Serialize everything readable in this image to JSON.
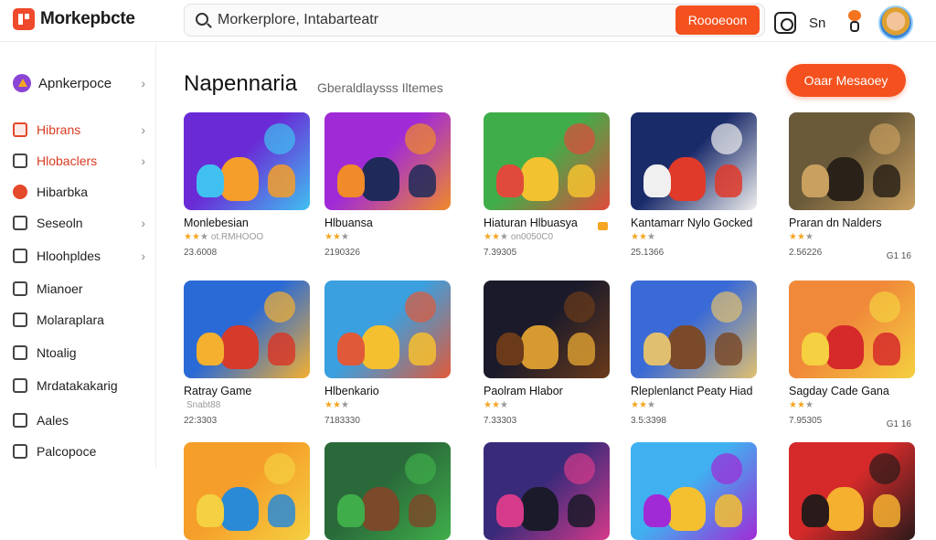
{
  "app": {
    "name": "Morkepbcte",
    "brand_color": "#f4511e"
  },
  "search": {
    "placeholder": "Morkerplore, Intabarteatr",
    "button_label": "Roooeoon"
  },
  "top_icons": {
    "language_label": "Sn"
  },
  "sidebar": {
    "header_label": "Apnkerpoce",
    "items": [
      {
        "label": "Hibrans",
        "icon": "tag-icon",
        "chevron": true,
        "active": true
      },
      {
        "label": "Hlobaclers",
        "icon": "controller-icon",
        "chevron": true,
        "active": true
      },
      {
        "label": "Hibarbka",
        "icon": "flame-icon",
        "chevron": false,
        "active": false
      },
      {
        "label": "Seseoln",
        "icon": "compass-icon",
        "chevron": true,
        "active": false
      },
      {
        "label": "Hloohpldes",
        "icon": "puzzle-icon",
        "chevron": true,
        "active": false
      },
      {
        "label": "Mianoer",
        "icon": "monitor-icon",
        "chevron": false,
        "active": false
      },
      {
        "label": "Molaraplara",
        "icon": "globe-icon",
        "chevron": false,
        "active": false
      },
      {
        "label": "Ntoalig",
        "icon": "chart-icon",
        "chevron": false,
        "active": false
      },
      {
        "label": "Mrdatakakarig",
        "icon": "grid-icon",
        "chevron": false,
        "active": false
      },
      {
        "label": "Aales",
        "icon": "calendar-icon",
        "chevron": false,
        "active": false
      },
      {
        "label": "Palcopoce",
        "icon": "image-icon",
        "chevron": false,
        "active": false
      }
    ]
  },
  "main": {
    "title": "Napennaria",
    "subtitle": "Gberaldlaysss Iltemes",
    "cta_label": "Oaar Mesaoey",
    "games": [
      {
        "name": "Monlebesian",
        "rating": 2,
        "rating_note": "ot.RMHOOO",
        "count": "23.6008",
        "extra": "",
        "colors": [
          "#6a2bd6",
          "#f59e2a",
          "#40c0f0"
        ]
      },
      {
        "name": "Hlbuansa",
        "rating": 2,
        "rating_note": "",
        "count": "2190326",
        "extra": "",
        "colors": [
          "#a02bd6",
          "#1f2a5a",
          "#f08a2a"
        ]
      },
      {
        "name": "Hiaturan Hlbuasya",
        "rating": 2,
        "rating_note": "on0050C0",
        "count": "7.39305",
        "extra": "",
        "colors": [
          "#3fae4a",
          "#f2c230",
          "#e04a3a"
        ]
      },
      {
        "name": "Kantamarr Nylo Gocked",
        "rating": 2,
        "rating_note": "",
        "count": "25.1366",
        "extra": "",
        "colors": [
          "#1a2b6a",
          "#e03a2a",
          "#f0f0f0"
        ]
      },
      {
        "name": "Praran dn Nalders",
        "rating": 2,
        "rating_note": "",
        "count": "2.56226",
        "extra": "G1 16",
        "colors": [
          "#6a5a3a",
          "#2a2218",
          "#c9a060"
        ]
      },
      {
        "name": "Ratray Game",
        "rating": 0,
        "rating_note": "Snabt88",
        "count": "22:3303",
        "extra": "",
        "colors": [
          "#2a6ad6",
          "#d63a2a",
          "#f5b030"
        ]
      },
      {
        "name": "Hlbenkario",
        "rating": 2,
        "rating_note": "",
        "count": "7183330",
        "extra": "",
        "colors": [
          "#3aa0e0",
          "#f5c030",
          "#e05a3a"
        ]
      },
      {
        "name": "Paolram Hlabor",
        "rating": 2,
        "rating_note": "",
        "count": "7.33303",
        "extra": "",
        "colors": [
          "#1a1a2a",
          "#d69a30",
          "#6a3a1a"
        ]
      },
      {
        "name": "Rleplenlanct Peaty Hiad",
        "rating": 2,
        "rating_note": "",
        "count": "3.5:3398",
        "extra": "",
        "colors": [
          "#3a6ad6",
          "#7a4a2a",
          "#e0c070"
        ]
      },
      {
        "name": "Sagday Cade Gana",
        "rating": 2,
        "rating_note": "",
        "count": "7.95305",
        "extra": "G1 16",
        "colors": [
          "#f08a3a",
          "#d62a2a",
          "#f5d040"
        ]
      },
      {
        "name": "",
        "rating": 0,
        "rating_note": "",
        "count": "",
        "extra": "",
        "colors": [
          "#f59e2a",
          "#2a8ad6",
          "#f5d040"
        ]
      },
      {
        "name": "",
        "rating": 0,
        "rating_note": "",
        "count": "",
        "extra": "",
        "colors": [
          "#2a6a3a",
          "#7a4a2a",
          "#3fae4a"
        ]
      },
      {
        "name": "",
        "rating": 0,
        "rating_note": "",
        "count": "",
        "extra": "",
        "colors": [
          "#3a2a7a",
          "#1a1a2a",
          "#d63a8a"
        ]
      },
      {
        "name": "",
        "rating": 0,
        "rating_note": "",
        "count": "",
        "extra": "",
        "colors": [
          "#40b0f0",
          "#f5c030",
          "#a02bd6"
        ]
      },
      {
        "name": "",
        "rating": 0,
        "rating_note": "",
        "count": "",
        "extra": "",
        "colors": [
          "#d62a2a",
          "#f5b030",
          "#2a1a1a"
        ]
      }
    ]
  }
}
